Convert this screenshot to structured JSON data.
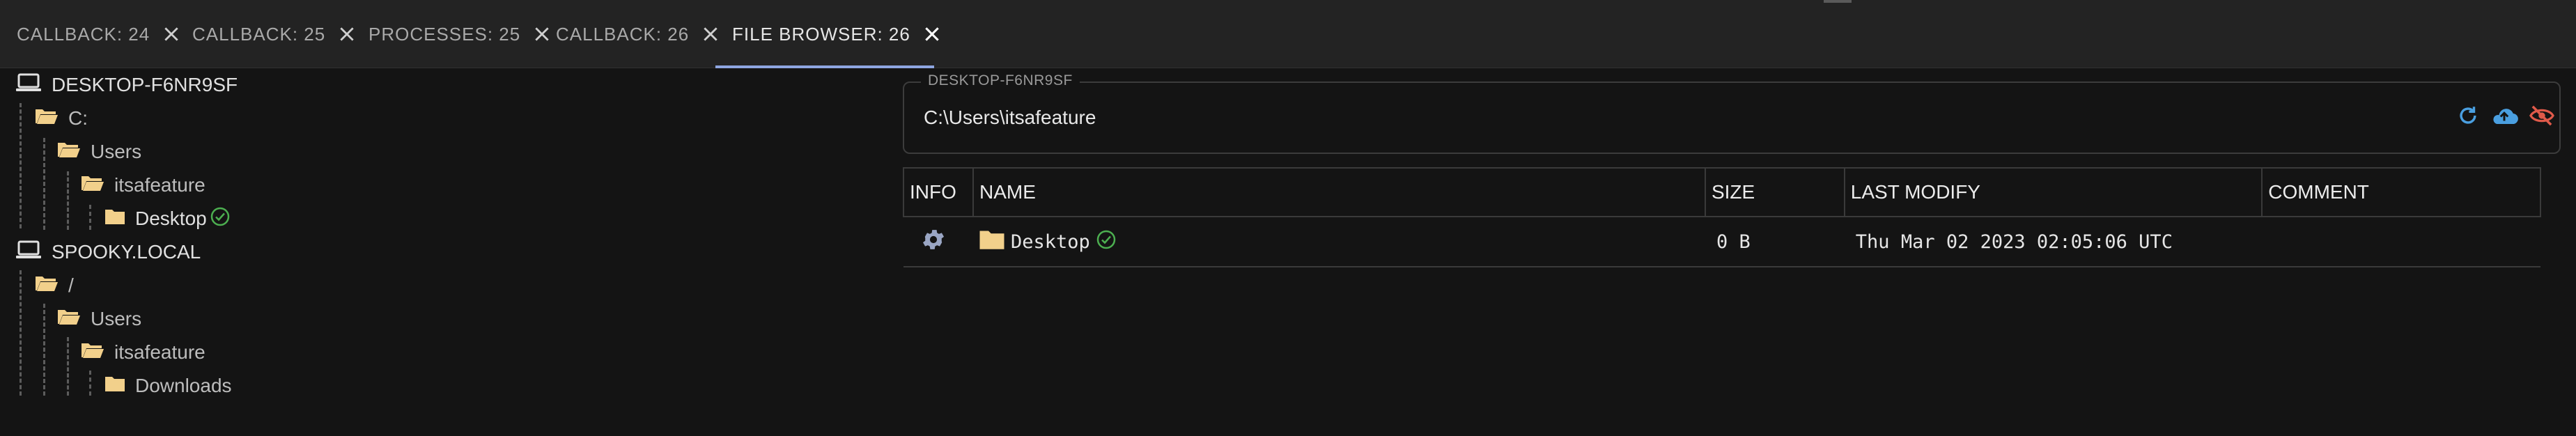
{
  "tabs": [
    {
      "label": "CALLBACK: 24"
    },
    {
      "label": "CALLBACK: 25"
    },
    {
      "label": "PROCESSES: 25"
    },
    {
      "label": "CALLBACK: 26"
    },
    {
      "label": "FILE BROWSER: 26",
      "active": true
    }
  ],
  "tree": {
    "hosts": [
      {
        "name": "DESKTOP-F6NR9SF",
        "children": [
          "C:",
          "Users",
          "itsafeature",
          "Desktop"
        ]
      },
      {
        "name": "SPOOKY.LOCAL",
        "children": [
          "/",
          "Users",
          "itsafeature",
          "Downloads"
        ]
      }
    ]
  },
  "path_field": {
    "legend": "DESKTOP-F6NR9SF",
    "value": "C:\\Users\\itsafeature"
  },
  "table": {
    "columns": [
      "INFO",
      "NAME",
      "SIZE",
      "LAST MODIFY",
      "COMMENT"
    ],
    "rows": [
      {
        "name": "Desktop",
        "size": "0 B",
        "last_modify": "Thu Mar 02 2023 02:05:06 UTC",
        "comment": ""
      }
    ]
  },
  "colors": {
    "accent": "#8ea5e0",
    "success": "#4caf50",
    "folder": "#f2d08b",
    "refresh": "#4a9fe0",
    "hide": "#e05a4a"
  }
}
